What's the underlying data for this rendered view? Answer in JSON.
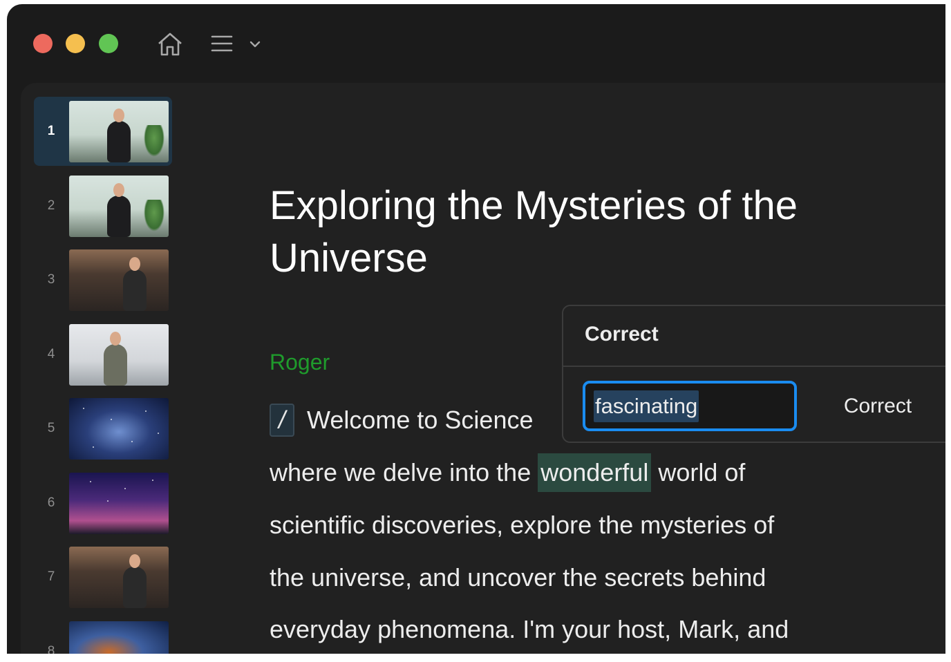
{
  "window": {
    "traffic_lights": [
      "close",
      "minimize",
      "zoom"
    ],
    "colors": {
      "close": "#ed6a5e",
      "minimize": "#f5bf4f",
      "zoom": "#61c554"
    }
  },
  "toolbar": {
    "icons": [
      "home-icon",
      "menu-icon",
      "chevron-down-icon"
    ]
  },
  "slides": [
    {
      "number": "1",
      "active": true
    },
    {
      "number": "2",
      "active": false
    },
    {
      "number": "3",
      "active": false
    },
    {
      "number": "4",
      "active": false
    },
    {
      "number": "5",
      "active": false
    },
    {
      "number": "6",
      "active": false
    },
    {
      "number": "7",
      "active": false
    },
    {
      "number": "8",
      "active": false
    }
  ],
  "document": {
    "title": "Exploring the Mysteries of the Universe",
    "speaker": "Roger",
    "speaker_color": "#1f9b2c",
    "marker": "/",
    "lines": {
      "l1": "Welcome to Science",
      "l2_before": "where we delve into the ",
      "l2_highlight": "wonderful",
      "l2_after": " world of",
      "l3": "scientific discoveries, explore the mysteries of",
      "l4": "the universe, and uncover the secrets behind",
      "l5": "everyday phenomena. I'm your host, Mark, and"
    }
  },
  "correct_popup": {
    "title": "Correct",
    "input_value": "fascinating",
    "button_label": "Correct",
    "accent": "#1a8cf0"
  }
}
